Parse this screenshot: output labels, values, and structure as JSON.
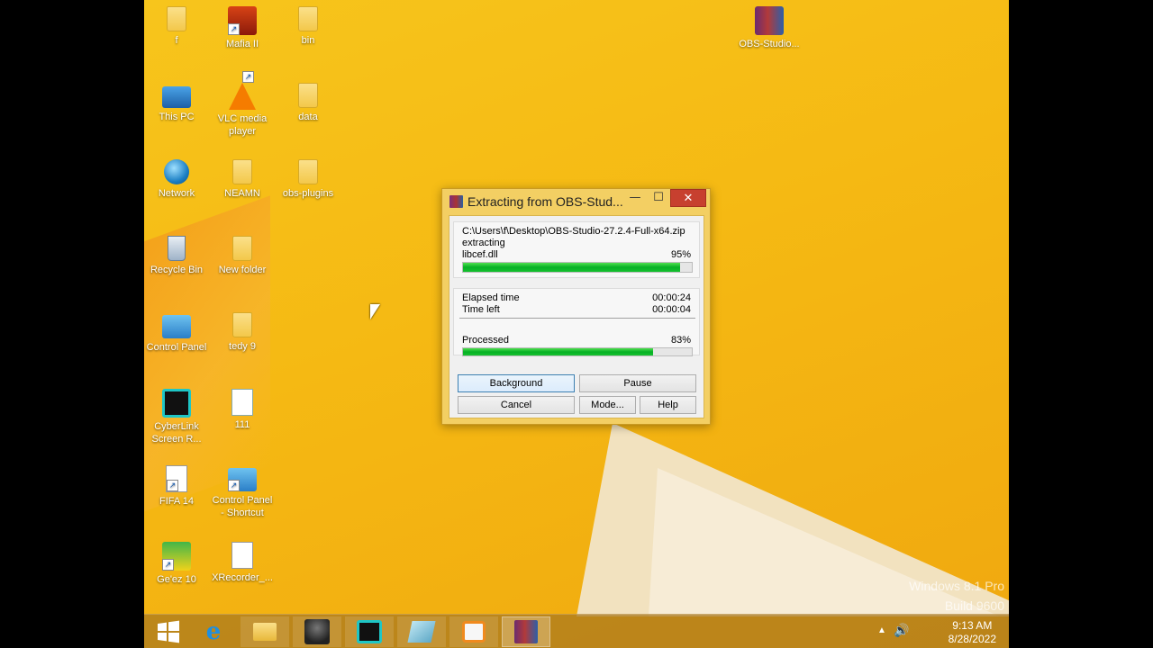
{
  "desktop": {
    "icons": [
      {
        "label": "f",
        "icon": "user-folder-icon"
      },
      {
        "label": "Mafia II",
        "icon": "mafia-game-icon"
      },
      {
        "label": "bin",
        "icon": "folder-icon"
      },
      {
        "label": "OBS-Studio...",
        "icon": "winrar-archive-icon"
      },
      {
        "label": "This PC",
        "icon": "computer-icon"
      },
      {
        "label": "VLC media player",
        "icon": "vlc-icon"
      },
      {
        "label": "data",
        "icon": "folder-icon"
      },
      {
        "label": "Network",
        "icon": "network-icon"
      },
      {
        "label": "NEAMN",
        "icon": "folder-icon"
      },
      {
        "label": "obs-plugins",
        "icon": "folder-icon"
      },
      {
        "label": "Recycle Bin",
        "icon": "recycle-bin-icon"
      },
      {
        "label": "New folder",
        "icon": "folder-icon"
      },
      {
        "label": "Control Panel",
        "icon": "control-panel-icon"
      },
      {
        "label": "tedy 9",
        "icon": "folder-icon"
      },
      {
        "label": "CyberLink Screen R...",
        "icon": "cyberlink-icon"
      },
      {
        "label": "111",
        "icon": "word-document-icon"
      },
      {
        "label": "FIFA 14",
        "icon": "file-shortcut-icon"
      },
      {
        "label": "Control Panel - Shortcut",
        "icon": "control-panel-icon"
      },
      {
        "label": "Ge'ez 10",
        "icon": "geez-keyboard-icon"
      },
      {
        "label": "XRecorder_...",
        "icon": "mp3-file-icon"
      }
    ],
    "watermark_line1": "Windows 8.1 Pro",
    "watermark_line2": "Build 9600"
  },
  "dialog": {
    "title": "Extracting from OBS-Stud...",
    "archive_path": "C:\\Users\\f\\Desktop\\OBS-Studio-27.2.4-Full-x64.zip",
    "action": "extracting",
    "current_file": "libcef.dll",
    "file_percent_text": "95%",
    "file_progress": 0.95,
    "elapsed_label": "Elapsed time",
    "elapsed_value": "00:00:24",
    "time_left_label": "Time left",
    "time_left_value": "00:00:04",
    "processed_label": "Processed",
    "processed_percent_text": "83%",
    "processed_progress": 0.83,
    "buttons": {
      "background": "Background",
      "pause": "Pause",
      "cancel": "Cancel",
      "mode": "Mode...",
      "help": "Help"
    },
    "controls": {
      "minimize": "—",
      "maximize": "☐",
      "close": "✕"
    }
  },
  "taskbar": {
    "items": [
      {
        "name": "start-button",
        "icon": "windows-logo-icon"
      },
      {
        "name": "internet-explorer",
        "icon": "ie-icon"
      },
      {
        "name": "file-explorer",
        "icon": "folder-icon"
      },
      {
        "name": "game-app",
        "icon": "soldier-icon"
      },
      {
        "name": "cyberlink-screen-recorder",
        "icon": "cyberlink-icon"
      },
      {
        "name": "app-generic",
        "icon": "book-icon"
      },
      {
        "name": "media-player",
        "icon": "media-player-icon"
      },
      {
        "name": "winrar",
        "icon": "winrar-icon"
      }
    ],
    "time": "9:13 AM",
    "date": "8/28/2022"
  }
}
